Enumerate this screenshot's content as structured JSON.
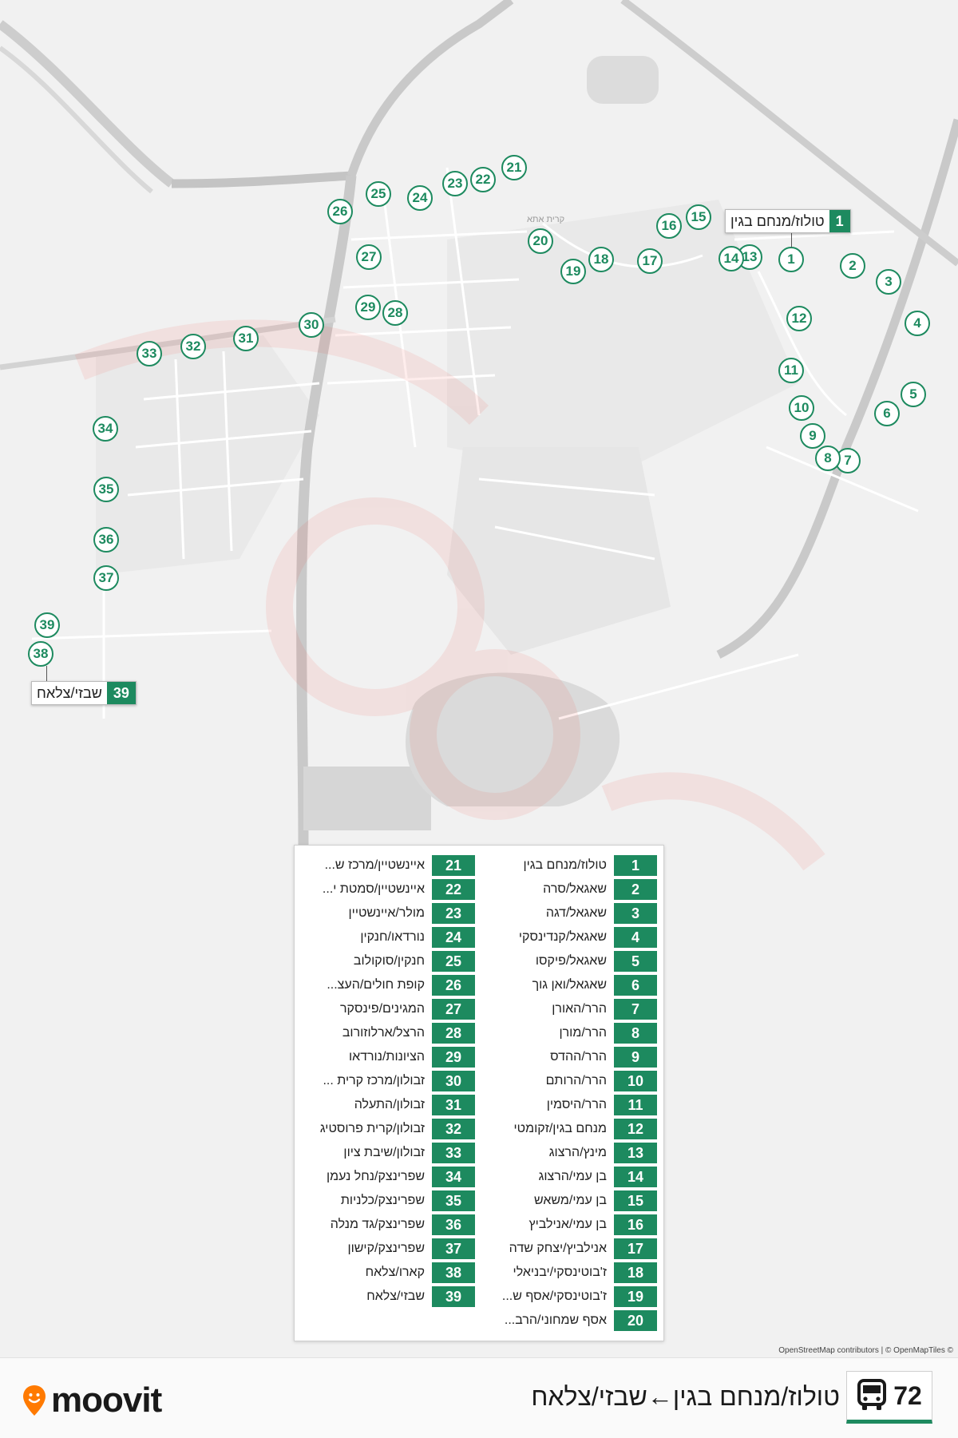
{
  "map": {
    "place_label": "קרית אתא",
    "attribution": "OpenStreetMap contributors | © OpenMapTiles ©",
    "start_label": {
      "number": "1",
      "name": "טולוז/מנחם בגין"
    },
    "end_label": {
      "number": "39",
      "name": "שבזי/צלאח"
    },
    "colors": {
      "accent": "#1d8a5f",
      "land": "#f1f1f1",
      "road": "#ffffff",
      "watermark": "#ef3b2c"
    }
  },
  "stops": [
    {
      "number": "1",
      "name": "טולוז/מנחם בגין"
    },
    {
      "number": "2",
      "name": "שאגאל/סרה"
    },
    {
      "number": "3",
      "name": "שאגאל/דגה"
    },
    {
      "number": "4",
      "name": "שאגאל/קנדינסקי"
    },
    {
      "number": "5",
      "name": "שאגאל/פיקסו"
    },
    {
      "number": "6",
      "name": "שאגאל/ואן גוך"
    },
    {
      "number": "7",
      "name": "הרר/האורן"
    },
    {
      "number": "8",
      "name": "הרר/מורן"
    },
    {
      "number": "9",
      "name": "הרר/ההדס"
    },
    {
      "number": "10",
      "name": "הרר/הרותם"
    },
    {
      "number": "11",
      "name": "הרר/היסמין"
    },
    {
      "number": "12",
      "name": "מנחם בגין/זקומטי"
    },
    {
      "number": "13",
      "name": "מינץ/הרצוג"
    },
    {
      "number": "14",
      "name": "בן עמי/הרצוג"
    },
    {
      "number": "15",
      "name": "בן עמי/משאש"
    },
    {
      "number": "16",
      "name": "בן עמי/אנילביץ"
    },
    {
      "number": "17",
      "name": "אנילביץ/יצחק שדה"
    },
    {
      "number": "18",
      "name": "ז'בוטינסקי/יבניאלי"
    },
    {
      "number": "19",
      "name": "ז'בוטינסקי/אסף ש..."
    },
    {
      "number": "20",
      "name": "אסף שמחוני/הרב..."
    },
    {
      "number": "21",
      "name": "איינשטיין/מרכז ש..."
    },
    {
      "number": "22",
      "name": "איינשטיין/סמטת י..."
    },
    {
      "number": "23",
      "name": "מולר/איינשטיין"
    },
    {
      "number": "24",
      "name": "נורדאו/חנקין"
    },
    {
      "number": "25",
      "name": "חנקין/סוקולוב"
    },
    {
      "number": "26",
      "name": "קופת חולים/העצ..."
    },
    {
      "number": "27",
      "name": "המגינים/פינסקר"
    },
    {
      "number": "28",
      "name": "הרצל/ארלוזורוב"
    },
    {
      "number": "29",
      "name": "הציונות/נורדאו"
    },
    {
      "number": "30",
      "name": "זבולון/מרכז קרית ..."
    },
    {
      "number": "31",
      "name": "זבולון/התעלה"
    },
    {
      "number": "32",
      "name": "זבולון/קרית פרוסטיג"
    },
    {
      "number": "33",
      "name": "זבולון/שיבת ציון"
    },
    {
      "number": "34",
      "name": "שפרינצק/נחל נעמן"
    },
    {
      "number": "35",
      "name": "שפרינצק/כלניות"
    },
    {
      "number": "36",
      "name": "שפרינצק/גד מנלה"
    },
    {
      "number": "37",
      "name": "שפרינצק/קישון"
    },
    {
      "number": "38",
      "name": "קארו/צלאח"
    },
    {
      "number": "39",
      "name": "שבזי/צלאח"
    }
  ],
  "footer": {
    "brand": "moovit",
    "route_number": "72",
    "route_title": "טולוז/מנחם בגין←שבזי/צלאח",
    "bus_icon": "bus-icon",
    "pin_icon": "moovit-pin-icon"
  }
}
